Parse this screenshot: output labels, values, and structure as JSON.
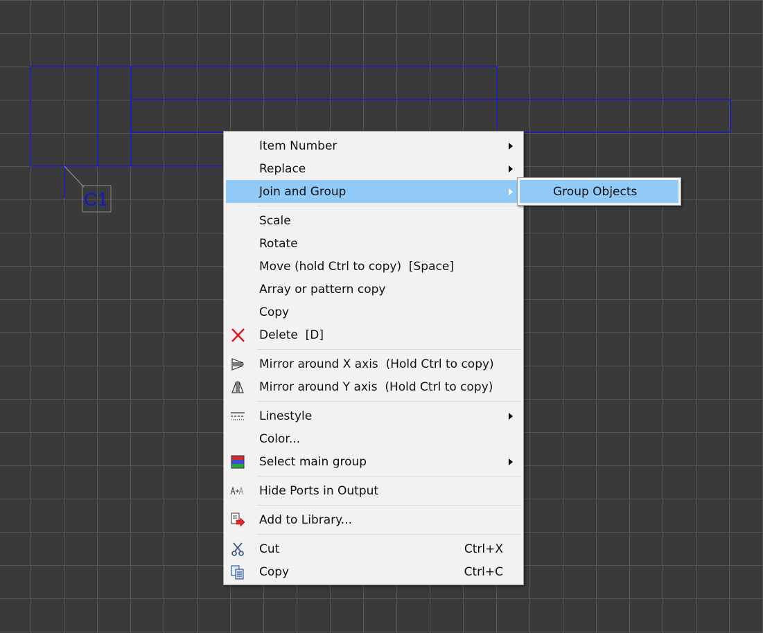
{
  "canvas": {
    "background": "#3a3a3a",
    "grid_color": "#555555",
    "shape_stroke": "#1515d8",
    "component_label": "C1"
  },
  "context_menu": {
    "items": [
      {
        "label": "Item Number",
        "submenu": true
      },
      {
        "label": "Replace",
        "submenu": true
      },
      {
        "label": "Join and Group",
        "submenu": true,
        "highlighted": true
      },
      {
        "label": "Scale"
      },
      {
        "label": "Rotate"
      },
      {
        "label": "Move (hold Ctrl to copy)  [Space]"
      },
      {
        "label": "Array or pattern copy"
      },
      {
        "label": "Copy"
      },
      {
        "label": "Delete  [D]",
        "icon": "delete-x-icon"
      },
      {
        "label": "Mirror around X axis  (Hold Ctrl to copy)",
        "icon": "mirror-x-icon"
      },
      {
        "label": "Mirror around Y axis  (Hold Ctrl to copy)",
        "icon": "mirror-y-icon"
      },
      {
        "label": "Linestyle",
        "icon": "linestyle-icon",
        "submenu": true
      },
      {
        "label": "Color..."
      },
      {
        "label": "Select main group",
        "icon": "color-group-icon",
        "submenu": true
      },
      {
        "label": "Hide Ports in Output",
        "icon": "hide-ports-icon"
      },
      {
        "label": "Add to Library...",
        "icon": "add-library-icon"
      },
      {
        "label": "Cut",
        "icon": "scissors-icon",
        "shortcut": "Ctrl+X"
      },
      {
        "label": "Copy",
        "icon": "copy-pages-icon",
        "shortcut": "Ctrl+C"
      }
    ],
    "highlight_color": "#91c9f7"
  },
  "submenu": {
    "items": [
      {
        "label": "Group Objects"
      }
    ]
  }
}
